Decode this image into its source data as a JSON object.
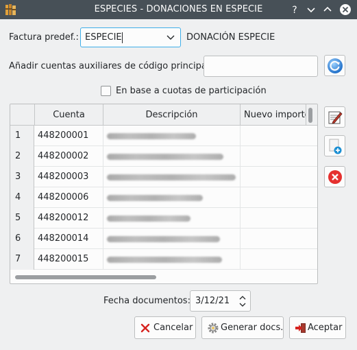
{
  "window": {
    "title": "ESPECIES - DONACIONES EN ESPECIE",
    "controls": {
      "help": "?",
      "minimize": "minimize",
      "maximize": "maximize",
      "close": "close"
    }
  },
  "factura": {
    "label": "Factura predef.:",
    "selected": "ESPECIE",
    "description": "DONACIÓN ESPECIE"
  },
  "auxiliares": {
    "label": "Añadir cuentas auxiliares de código principal:",
    "value": ""
  },
  "cuotas": {
    "label": "En base a cuotas de participación",
    "checked": false
  },
  "table": {
    "columns": [
      "Cuenta",
      "Descripción",
      "Nuevo importe"
    ],
    "rows": [
      {
        "num": "1",
        "cuenta": "448200001"
      },
      {
        "num": "2",
        "cuenta": "448200002"
      },
      {
        "num": "3",
        "cuenta": "448200003"
      },
      {
        "num": "4",
        "cuenta": "448200006"
      },
      {
        "num": "5",
        "cuenta": "448200012"
      },
      {
        "num": "6",
        "cuenta": "448200014"
      },
      {
        "num": "7",
        "cuenta": "448200015"
      }
    ]
  },
  "fecha": {
    "label": "Fecha documentos:",
    "value": "3/12/21"
  },
  "buttons": {
    "cancel": "Cancelar",
    "generate": "Generar docs.",
    "accept": "Aceptar"
  },
  "icons": {
    "app": "folders-icon",
    "refresh": "refresh-icon",
    "edit": "edit-icon",
    "add": "add-document-icon",
    "delete": "delete-icon",
    "cancel": "red-x-icon",
    "generate": "gear-icon",
    "accept": "exit-arrow-icon"
  },
  "colors": {
    "titlebar": "#475057",
    "focus": "#3daee9",
    "delete": "#e5302f",
    "add": "#1b8fd3"
  }
}
